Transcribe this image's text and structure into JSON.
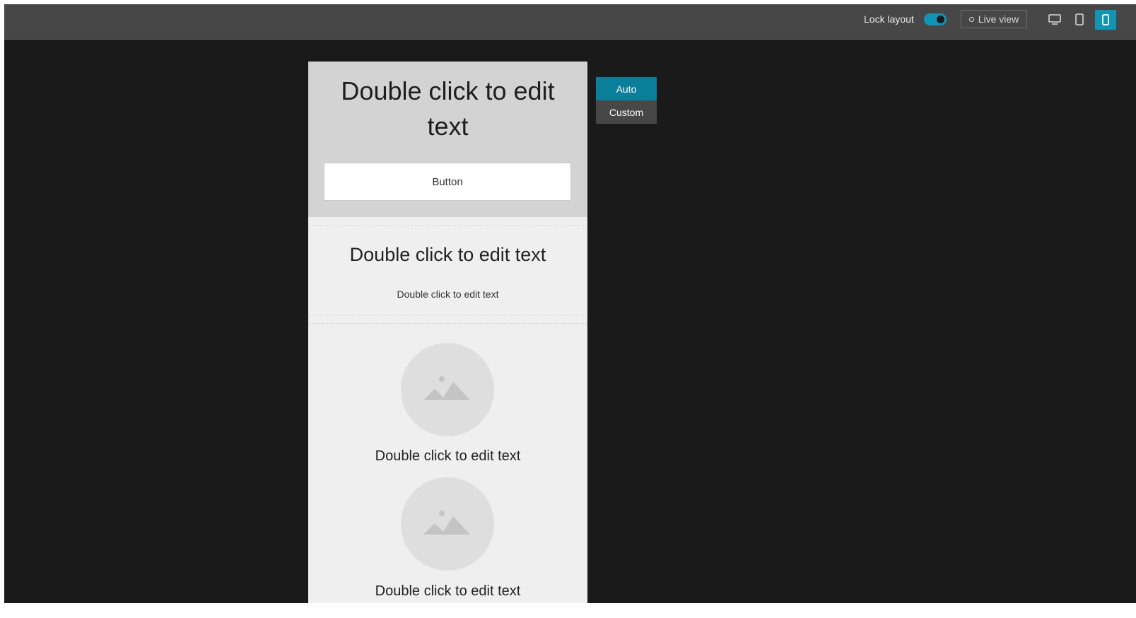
{
  "toolbar": {
    "lock_layout_label": "Lock layout",
    "lock_layout_on": true,
    "live_view_label": "Live view",
    "devices": [
      {
        "name": "desktop",
        "icon": "desktop-icon",
        "active": false
      },
      {
        "name": "tablet",
        "icon": "tablet-icon",
        "active": false
      },
      {
        "name": "phone",
        "icon": "phone-icon",
        "active": true
      }
    ],
    "accent_color": "#1096b5"
  },
  "size_menu": {
    "options": [
      "Auto",
      "Custom"
    ],
    "selected": "Auto"
  },
  "page": {
    "hero": {
      "title": "Double click to edit text",
      "button_label": "Button"
    },
    "section2": {
      "title": "Double click to edit text",
      "subtitle": "Double click to edit text"
    },
    "gallery": [
      {
        "icon": "image-placeholder-icon",
        "caption": "Double click to edit text"
      },
      {
        "icon": "image-placeholder-icon",
        "caption": "Double click to edit text"
      }
    ]
  }
}
